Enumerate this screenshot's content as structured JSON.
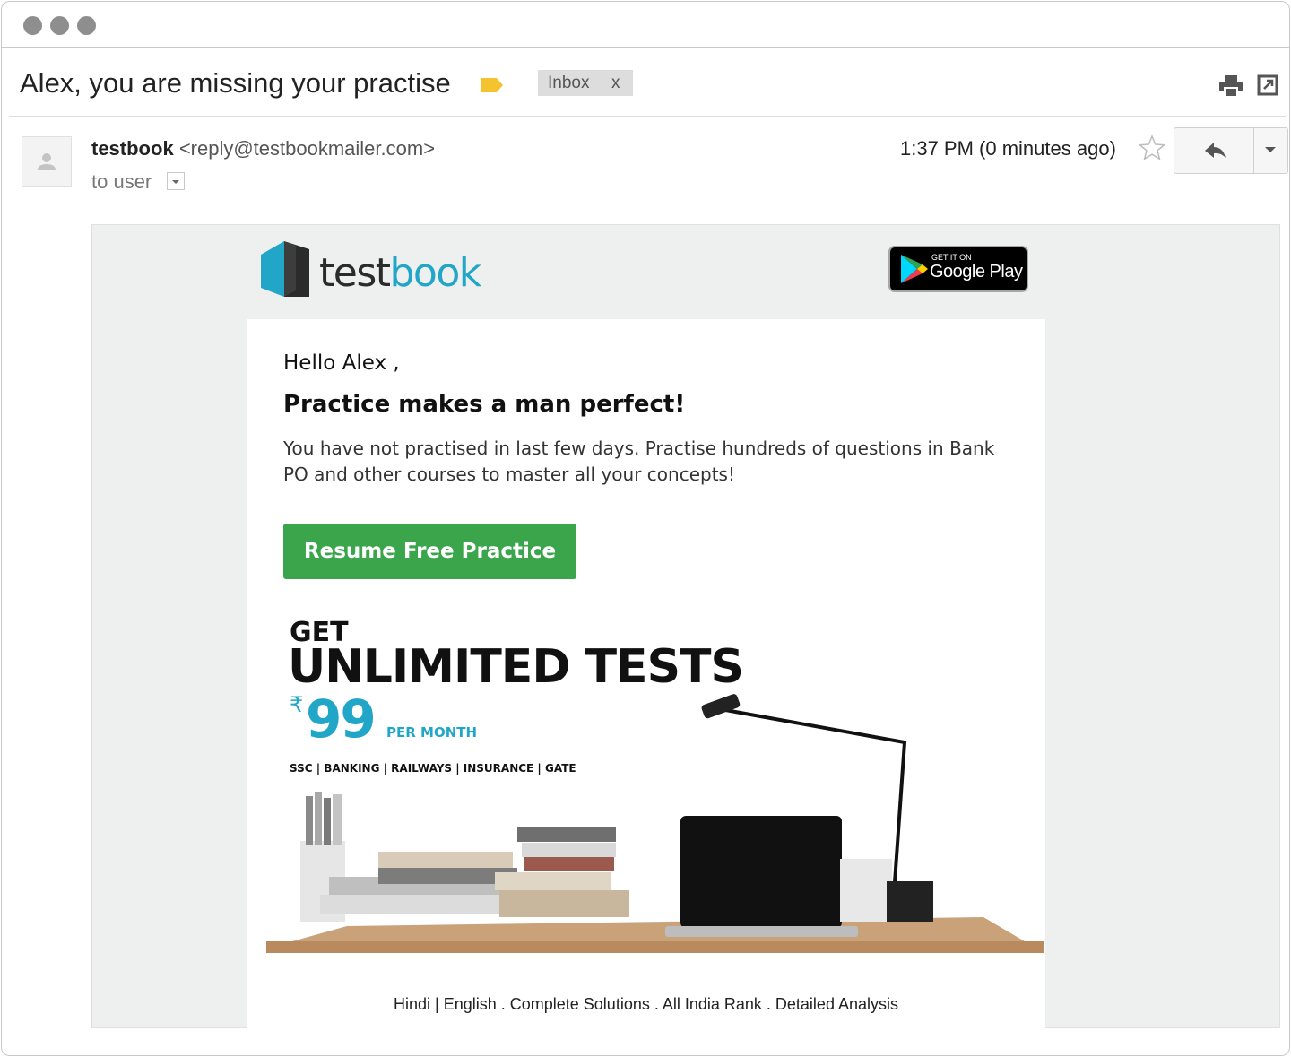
{
  "window": {
    "controls": [
      "close",
      "minimize",
      "maximize"
    ]
  },
  "subject": {
    "title": "Alex, you are missing your practise",
    "label_icon": "label-tag-icon",
    "label_color": "#f4c430",
    "inbox_label": "Inbox",
    "inbox_remove": "x"
  },
  "header_actions": {
    "print_icon": "print-icon",
    "popout_icon": "popout-icon"
  },
  "message": {
    "sender_name": "testbook",
    "sender_address": "<reply@testbookmailer.com>",
    "recipient": "to user",
    "time": "1:37 PM (0 minutes ago)",
    "star_icon": "star-icon",
    "reply_icon": "reply-icon",
    "more_icon": "chevron-down-icon"
  },
  "email": {
    "brand": {
      "part1": "test",
      "part2": "book",
      "colors": {
        "dark": "#2b2b2b",
        "accent": "#21a6c8"
      }
    },
    "store_badge": {
      "small": "GET IT ON",
      "big": "Google Play"
    },
    "greeting": "Hello Alex ,",
    "headline": "Practice makes a man perfect!",
    "paragraph": "You have not practised in last few days. Practise hundreds of questions in Bank PO  and other courses to master all your concepts!",
    "cta_label": "Resume Free Practice",
    "cta_color": "#3aa54b",
    "promo": {
      "get": "GET",
      "headline": "UNLIMITED TESTS",
      "currency": "₹",
      "price": "99",
      "per": "PER MONTH",
      "categories": "SSC | BANKING | RAILWAYS | INSURANCE | GATE"
    },
    "footer": "Hindi | English . Complete Solutions . All India Rank . Detailed Analysis"
  }
}
